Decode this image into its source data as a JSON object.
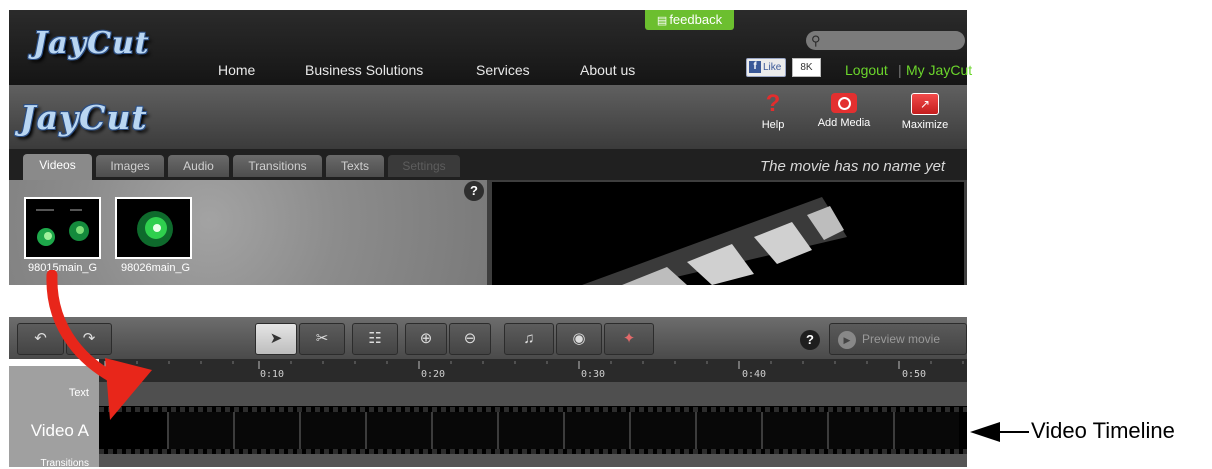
{
  "site_header": {
    "logo": "JayCut",
    "feedback_label": "feedback",
    "nav": [
      "Home",
      "Business Solutions",
      "Services",
      "About us"
    ],
    "fb_like_label": "Like",
    "fb_like_count": "8K",
    "logout_label": "Logout",
    "link_separator": "|",
    "my_account_label": "My JayCut"
  },
  "editor_bar": {
    "logo": "JayCut",
    "tools": [
      {
        "label": "Help",
        "icon": "help-icon"
      },
      {
        "label": "Add Media",
        "icon": "camera-plus-icon"
      },
      {
        "label": "Maximize",
        "icon": "maximize-icon"
      }
    ]
  },
  "media_tabs": [
    "Videos",
    "Images",
    "Audio",
    "Transitions",
    "Texts",
    "Settings"
  ],
  "active_tab": "Videos",
  "movie_name": "The movie has no name yet",
  "media_items": [
    "98015main_G",
    "98026main_G"
  ],
  "timeline_controls": {
    "preview_label": "Preview movie"
  },
  "timeline": {
    "ticks": [
      "0:10",
      "0:20",
      "0:30",
      "0:40",
      "0:50"
    ],
    "tracks": [
      "Text",
      "Video A",
      "Transitions"
    ]
  },
  "annotation": {
    "label": "Video Timeline",
    "color": "#000000",
    "drag_arrow_color": "#e8261a"
  },
  "colors": {
    "accent_green": "#6cbf2f",
    "link_green": "#6cd62c",
    "tool_red": "#e33030"
  }
}
